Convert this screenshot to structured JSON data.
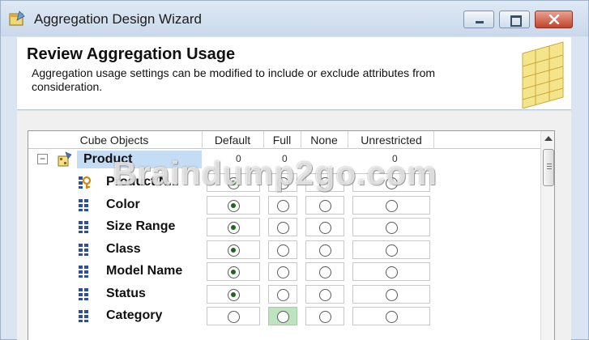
{
  "window": {
    "title": "Aggregation Design Wizard",
    "icon": "wizard-icon"
  },
  "header": {
    "title": "Review Aggregation Usage",
    "description": "Aggregation usage settings can be modified to include or exclude attributes from consideration."
  },
  "grid": {
    "columns": [
      "Cube Objects",
      "Default",
      "Full",
      "None",
      "Unrestricted"
    ],
    "dimension": {
      "label": "Product",
      "icon": "dimension-icon",
      "expanded": true,
      "header_mark": "0"
    },
    "attributes": [
      {
        "label": "Product N...",
        "icon": "key-attribute-icon",
        "selected": "Default"
      },
      {
        "label": "Color",
        "icon": "attribute-icon",
        "selected": "Default"
      },
      {
        "label": "Size Range",
        "icon": "attribute-icon",
        "selected": "Default"
      },
      {
        "label": "Class",
        "icon": "attribute-icon",
        "selected": "Default"
      },
      {
        "label": "Model Name",
        "icon": "attribute-icon",
        "selected": "Default"
      },
      {
        "label": "Status",
        "icon": "attribute-icon",
        "selected": "Default"
      },
      {
        "label": "Category",
        "icon": "attribute-icon",
        "selected": "",
        "highlighted_column": "Full"
      }
    ]
  },
  "watermark": "Braindump2go.com",
  "colors": {
    "selection_blue": "#c4dcf4",
    "highlight_green": "#bfe3bf",
    "radio_dot": "#1a6a1a"
  }
}
